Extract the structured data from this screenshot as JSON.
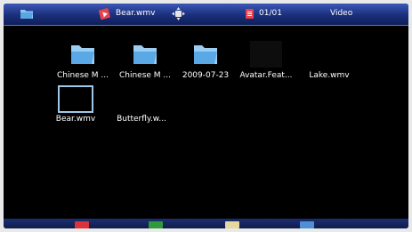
{
  "header": {
    "current_file": "Bear.wmv",
    "page": "01/01",
    "mode": "Video"
  },
  "items": [
    {
      "label": "Chinese M ...",
      "type": "folder"
    },
    {
      "label": "Chinese M ...",
      "type": "folder"
    },
    {
      "label": "2009-07-23",
      "type": "folder"
    },
    {
      "label": "Avatar.Feat...",
      "type": "video"
    },
    {
      "label": "Lake.wmv",
      "type": "video"
    },
    {
      "label": "Bear.wmv",
      "type": "video",
      "selected": true
    },
    {
      "label": "Butterfly.w...",
      "type": "video"
    }
  ],
  "color_keys": {
    "red": "#d9343a",
    "green": "#2f9a3a",
    "yellow": "#e6d7a0",
    "blue": "#4f8fd6"
  },
  "colors": {
    "folder": "#6fb3ea",
    "header_bg": "#1a2f7a",
    "selection_border": "#9ec9ea"
  }
}
